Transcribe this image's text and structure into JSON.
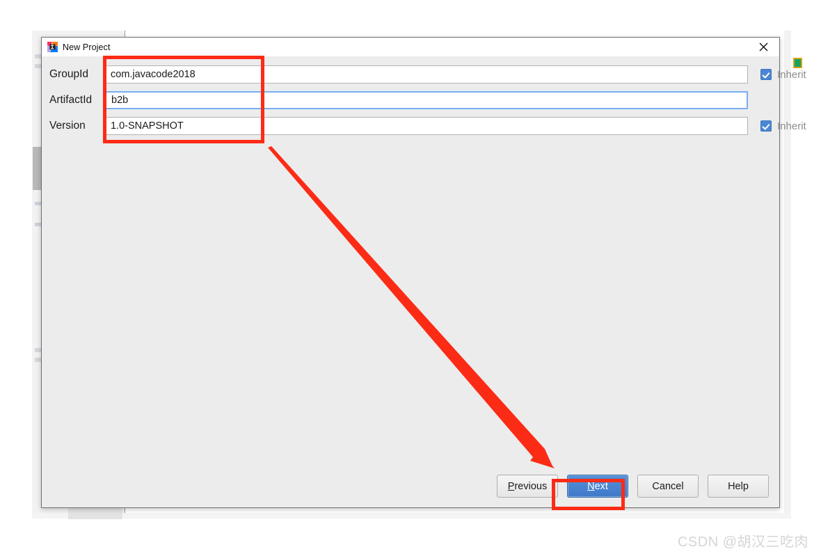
{
  "window": {
    "title": "New Project",
    "icon": "intellij-idea-icon",
    "close_icon": "close-icon"
  },
  "form": {
    "rows": [
      {
        "label": "GroupId",
        "value": "com.javacode2018",
        "focused": false,
        "inherit_label": "Inherit",
        "inherit_checked": true,
        "has_inherit": true
      },
      {
        "label": "ArtifactId",
        "value": "b2b",
        "focused": true,
        "inherit_label": "",
        "inherit_checked": false,
        "has_inherit": false
      },
      {
        "label": "Version",
        "value": "1.0-SNAPSHOT",
        "focused": false,
        "inherit_label": "Inherit",
        "inherit_checked": true,
        "has_inherit": true
      }
    ]
  },
  "footer": {
    "previous": {
      "pre": "",
      "accel": "P",
      "post": "revious"
    },
    "next": {
      "pre": "",
      "accel": "N",
      "post": "ext"
    },
    "cancel": {
      "label": "Cancel"
    },
    "help": {
      "label": "Help"
    }
  },
  "annotations": {
    "fields_box": "red-highlight-box-fields",
    "next_box": "red-highlight-box-next",
    "arrow": "red-arrow-pointing-to-next",
    "arrow_color": "#fc2b16"
  },
  "watermark": {
    "text": "CSDN @胡汉三吃肉"
  },
  "colors": {
    "dialog_bg": "#ececec",
    "accent_blue": "#4a86d4",
    "annotation_red": "#fc2b16",
    "focus_border": "#7aaeea"
  }
}
